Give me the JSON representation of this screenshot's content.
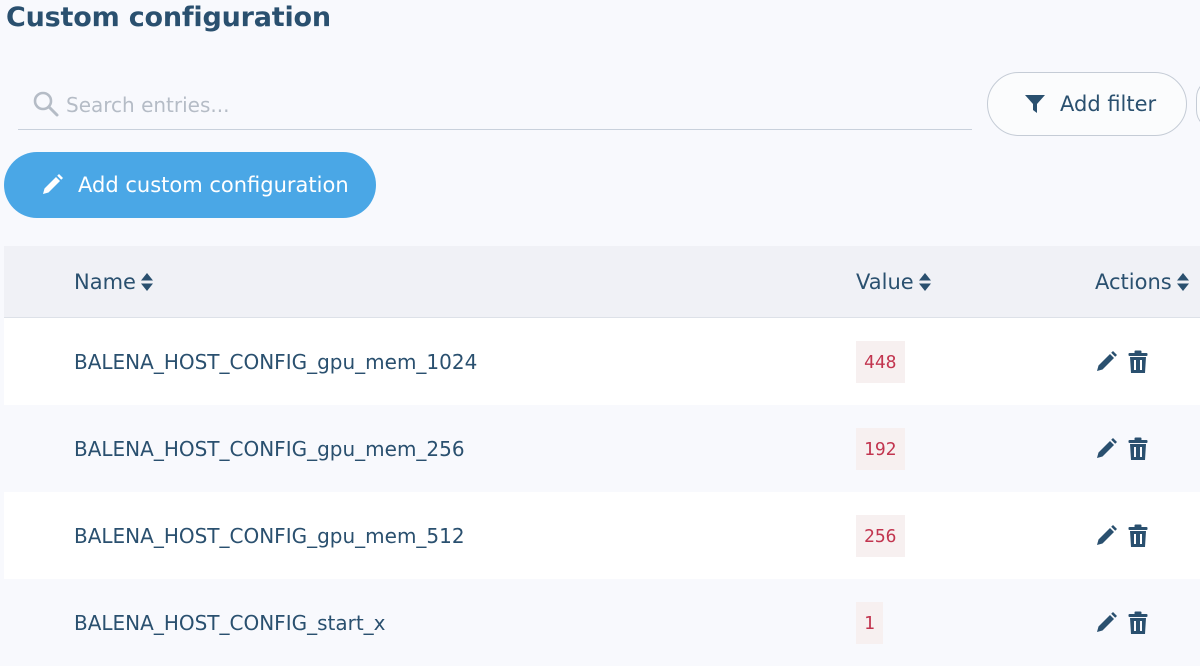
{
  "page": {
    "title": "Custom configuration"
  },
  "search": {
    "placeholder": "Search entries...",
    "value": "",
    "icon": "search-icon"
  },
  "toolbar": {
    "filter_label": "Add filter",
    "filter_icon": "funnel-icon",
    "add_label": "Add custom configuration",
    "add_icon": "pencil-icon"
  },
  "table": {
    "columns": [
      {
        "label": "Name",
        "sortable": true
      },
      {
        "label": "Value",
        "sortable": true
      },
      {
        "label": "Actions",
        "sortable": true
      }
    ],
    "rows": [
      {
        "name": "BALENA_HOST_CONFIG_gpu_mem_1024",
        "value": "448"
      },
      {
        "name": "BALENA_HOST_CONFIG_gpu_mem_256",
        "value": "192"
      },
      {
        "name": "BALENA_HOST_CONFIG_gpu_mem_512",
        "value": "256"
      },
      {
        "name": "BALENA_HOST_CONFIG_start_x",
        "value": "1"
      }
    ],
    "row_actions": [
      "edit-icon",
      "trash-icon"
    ]
  },
  "colors": {
    "text": "#2a506f",
    "accent": "#4aa7e6",
    "value_text": "#c2354f",
    "value_bg": "#f7f0f0"
  }
}
